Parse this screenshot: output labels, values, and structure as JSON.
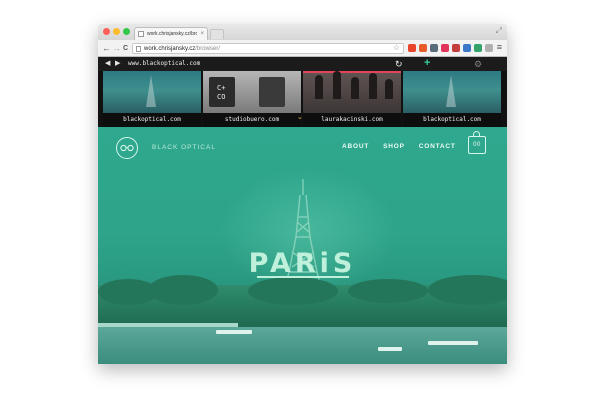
{
  "browser": {
    "tab_title": "work.chrisjansky.cz/brow",
    "tab_close": "×",
    "url_host": "work.chrisjansky.cz",
    "url_path": "/browser/",
    "back_glyph": "←",
    "forward_glyph": "→",
    "reload_glyph": "C",
    "star_glyph": "☆",
    "menu_glyph": "≡",
    "fullscreen_glyph": "⤢",
    "extension_colors": [
      "#e8452c",
      "#e85c2c",
      "#5a6b7a",
      "#e0365c",
      "#c43d3d",
      "#3a78c9",
      "#33a36b",
      "#b0b0b0"
    ]
  },
  "site_browser": {
    "back_glyph": "◀",
    "forward_glyph": "▶",
    "current_url": "www.blackoptical.com",
    "reload_glyph": "↻",
    "add_glyph": "+",
    "settings_glyph": "⚙",
    "thumbnails": [
      {
        "label": "blackoptical.com"
      },
      {
        "label": "studiobuero.com"
      },
      {
        "label": "laurakacinski.com"
      },
      {
        "label": "blackoptical.com"
      }
    ],
    "studio_mark": "C+\nCO",
    "selected_indicator": "⌄"
  },
  "website": {
    "brand": "BLACK OPTICAL",
    "logo_icon": "glasses-icon",
    "nav": [
      "ABOUT",
      "SHOP",
      "CONTACT"
    ],
    "cart_count": "00",
    "hero_title": "PARiS"
  }
}
